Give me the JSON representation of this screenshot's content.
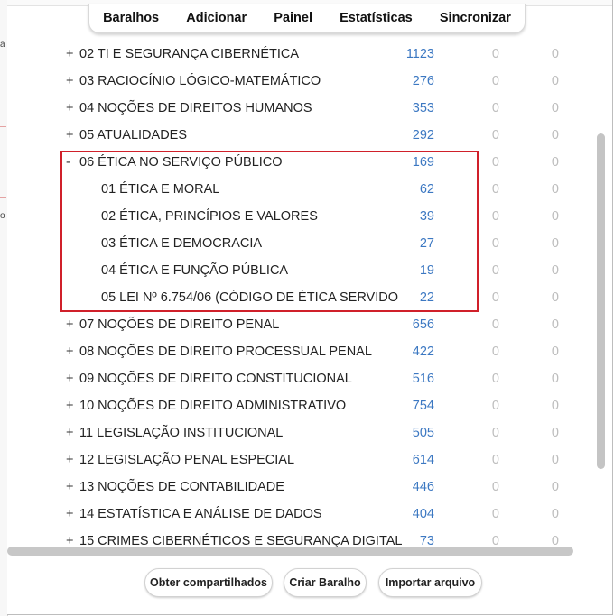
{
  "toolbar": {
    "decks": "Baralhos",
    "add": "Adicionar",
    "dashboard": "Painel",
    "stats": "Estatísticas",
    "sync": "Sincronizar"
  },
  "decks": [
    {
      "toggle": "+",
      "name": "02 TI E SEGURANÇA CIBERNÉTICA",
      "due": "1123",
      "new": "0",
      "learn": "0"
    },
    {
      "toggle": "+",
      "name": "03 RACIOCÍNIO LÓGICO-MATEMÁTICO",
      "due": "276",
      "new": "0",
      "learn": "0"
    },
    {
      "toggle": "+",
      "name": "04 NOÇÕES DE DIREITOS HUMANOS",
      "due": "353",
      "new": "0",
      "learn": "0"
    },
    {
      "toggle": "+",
      "name": "05 ATUALIDADES",
      "due": "292",
      "new": "0",
      "learn": "0"
    },
    {
      "toggle": "-",
      "name": "06 ÉTICA NO SERVIÇO PÚBLICO",
      "due": "169",
      "new": "0",
      "learn": "0"
    },
    {
      "toggle": "",
      "name": "01 ÉTICA E MORAL",
      "due": "62",
      "new": "0",
      "learn": "0"
    },
    {
      "toggle": "",
      "name": "02 ÉTICA, PRINCÍPIOS E VALORES",
      "due": "39",
      "new": "0",
      "learn": "0"
    },
    {
      "toggle": "",
      "name": "03 ÉTICA E DEMOCRACIA",
      "due": "27",
      "new": "0",
      "learn": "0"
    },
    {
      "toggle": "",
      "name": "04 ÉTICA E FUNÇÃO PÚBLICA",
      "due": "19",
      "new": "0",
      "learn": "0"
    },
    {
      "toggle": "",
      "name": "05 LEI Nº 6.754/06 (CÓDIGO DE ÉTICA SERVIDO",
      "due": "22",
      "new": "0",
      "learn": "0"
    },
    {
      "toggle": "+",
      "name": "07 NOÇÕES DE DIREITO PENAL",
      "due": "656",
      "new": "0",
      "learn": "0"
    },
    {
      "toggle": "+",
      "name": "08 NOÇÕES DE DIREITO PROCESSUAL PENAL",
      "due": "422",
      "new": "0",
      "learn": "0"
    },
    {
      "toggle": "+",
      "name": "09 NOÇÕES DE DIREITO CONSTITUCIONAL",
      "due": "516",
      "new": "0",
      "learn": "0"
    },
    {
      "toggle": "+",
      "name": "10 NOÇÕES DE DIREITO ADMINISTRATIVO",
      "due": "754",
      "new": "0",
      "learn": "0"
    },
    {
      "toggle": "+",
      "name": "11 LEGISLAÇÃO INSTITUCIONAL",
      "due": "505",
      "new": "0",
      "learn": "0"
    },
    {
      "toggle": "+",
      "name": "12 LEGISLAÇÃO PENAL ESPECIAL",
      "due": "614",
      "new": "0",
      "learn": "0"
    },
    {
      "toggle": "+",
      "name": "13 NOÇÕES DE CONTABILIDADE",
      "due": "446",
      "new": "0",
      "learn": "0"
    },
    {
      "toggle": "+",
      "name": "14 ESTATÍSTICA E ANÁLISE DE DADOS",
      "due": "404",
      "new": "0",
      "learn": "0"
    },
    {
      "toggle": "+",
      "name": "15 CRIMES CIBERNÉTICOS E SEGURANÇA DIGITAL",
      "due": "73",
      "new": "0",
      "learn": "0"
    }
  ],
  "bottom": {
    "get_shared": "Obter compartilhados",
    "create_deck": "Criar Baralho",
    "import_file": "Importar arquivo"
  },
  "colors": {
    "due": "#3c78c2",
    "zero": "#bdbdbd",
    "highlight": "#d0202a"
  }
}
